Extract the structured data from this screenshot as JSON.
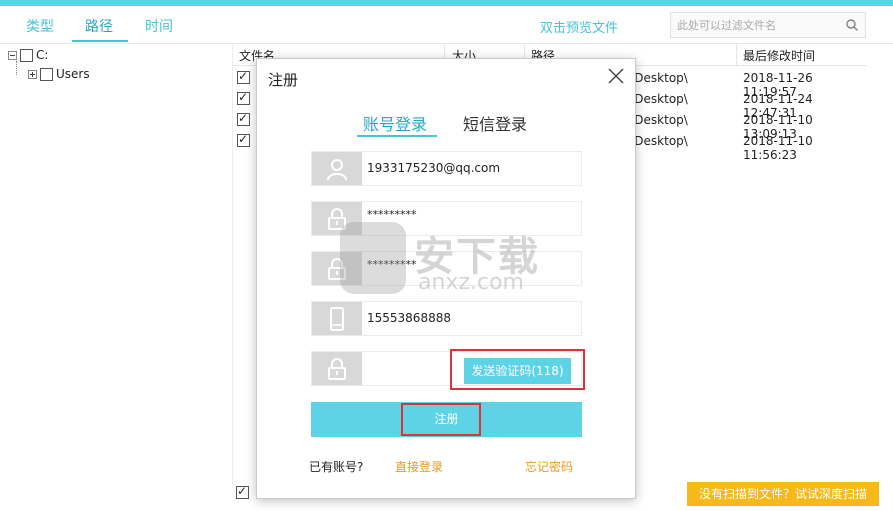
{
  "topbar": {
    "tabs": [
      {
        "label": "类型"
      },
      {
        "label": "路径"
      },
      {
        "label": "时间"
      }
    ],
    "preview_label": "双击预览文件",
    "filter_placeholder": "此处可以过滤文件名"
  },
  "tree": {
    "root": "C:",
    "child": "Users"
  },
  "table": {
    "headers": {
      "name": "文件名",
      "size": "大小",
      "path": "路径",
      "modified": "最后修改时间"
    },
    "rows": [
      {
        "path": "rator\\Desktop\\",
        "time": "2018-11-26 11:19:57"
      },
      {
        "path": "rator\\Desktop\\",
        "time": "2018-11-24 12:47:31"
      },
      {
        "path": "rator\\Desktop\\",
        "time": "2018-11-10 13:09:13"
      },
      {
        "path": "rator\\Desktop\\",
        "time": "2018-11-10 11:56:23"
      }
    ]
  },
  "cta_label": "没有扫描到文件？试试深度扫描",
  "dialog": {
    "title": "注册",
    "tabs": {
      "account": "账号登录",
      "sms": "短信登录"
    },
    "fields": {
      "account": "1933175230@qq.com",
      "password": "*********",
      "confirm_password": "*********",
      "phone": "15553868888",
      "code": ""
    },
    "send_code_label": "发送验证码(118)",
    "register_label": "注册",
    "has_account": "已有账号?",
    "direct_login": "直接登录",
    "forgot_password": "忘记密码"
  },
  "watermark": {
    "big": "安下载",
    "small": "anxz.com"
  },
  "colors": {
    "accent": "#5ed3e6",
    "tab_text": "#46c3d8",
    "orange_link": "#e89a1f",
    "cta": "#f7b919",
    "highlight": "#d8343a"
  }
}
